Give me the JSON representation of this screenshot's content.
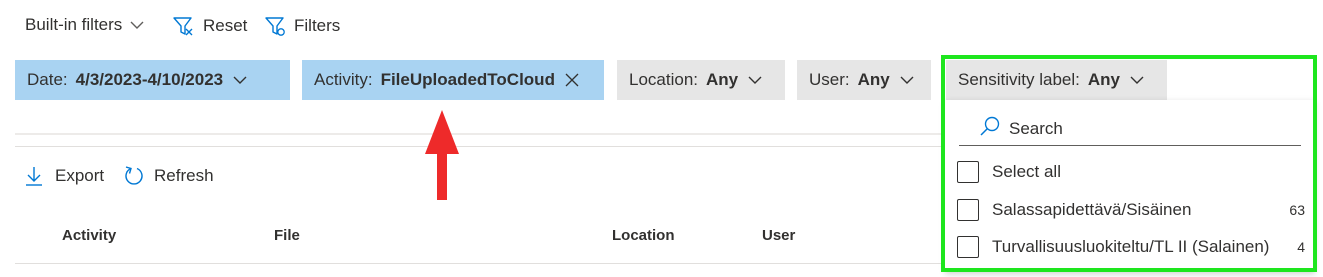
{
  "toolbar": {
    "builtin_filters": "Built-in filters",
    "reset": "Reset",
    "filters": "Filters"
  },
  "filters": {
    "date": {
      "label": "Date:",
      "value": "4/3/2023-4/10/2023"
    },
    "activity": {
      "label": "Activity:",
      "value": "FileUploadedToCloud"
    },
    "location": {
      "label": "Location:",
      "value": "Any"
    },
    "user": {
      "label": "User:",
      "value": "Any"
    },
    "sensitivity": {
      "label": "Sensitivity label:",
      "value": "Any"
    }
  },
  "actions": {
    "export": "Export",
    "refresh": "Refresh"
  },
  "table": {
    "columns": [
      "Activity",
      "File",
      "Location",
      "User"
    ]
  },
  "dropdown": {
    "search_placeholder": "Search",
    "options": [
      {
        "label": "Select all",
        "count": ""
      },
      {
        "label": "Salassapidettävä/Sisäinen",
        "count": "63"
      },
      {
        "label": "Turvallisuusluokiteltu/TL II (Salainen)",
        "count": "4"
      }
    ]
  },
  "colors": {
    "active_filter": "#a9d3f2",
    "inactive_filter": "#e6e6e6",
    "accent": "#0078d4",
    "highlight_box": "#1ee61e",
    "arrow": "#ee2a2a"
  },
  "icons": [
    "chevron-down-icon",
    "reset-filter-icon",
    "filter-icon",
    "close-icon",
    "download-icon",
    "refresh-icon",
    "search-icon"
  ]
}
